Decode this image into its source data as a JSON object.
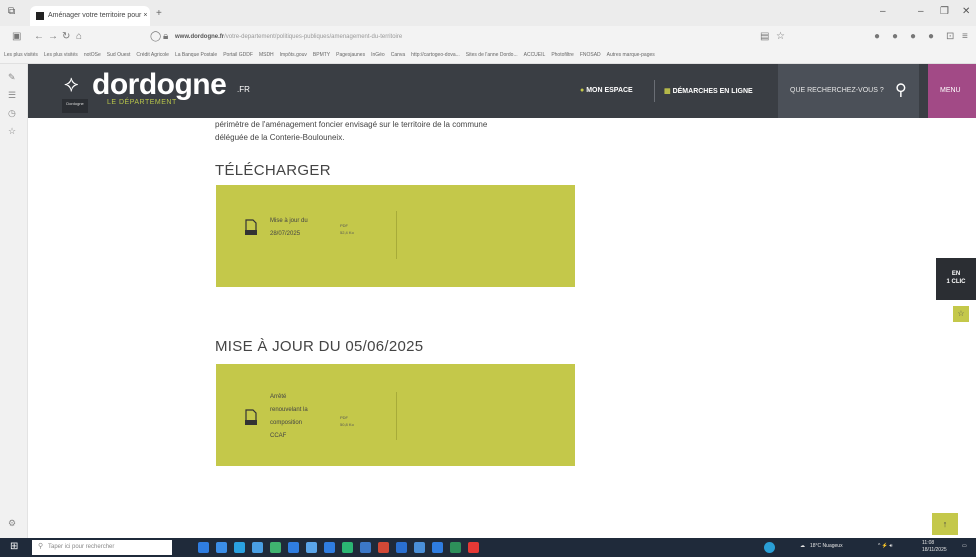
{
  "browser": {
    "tab_title": "Aménager votre territoire pour ×",
    "tab_close": "×",
    "new_tab": "+",
    "url_host": "www.dordogne.fr",
    "url_path": "/votre-departement/politiques-publiques/amenagement-du-territoire",
    "bookmarks": [
      "Les plus visités",
      "Les plus visités",
      "notOSe",
      "Sud Ouest",
      "Crédit Agricole",
      "La Banque Postale",
      "Portail GDDF",
      "MSDH",
      "Impôts.gouv",
      "BPMTY",
      "Pagesjaunes",
      "InGéo",
      "Canva",
      "http://cartogeo-dova...",
      "Sites de l'anne Dordo...",
      "ACCUEIL",
      "Photofiltre",
      "FNOSAD",
      "Autres marque-pages"
    ]
  },
  "site": {
    "logo_text": "dordogne",
    "logo_suffix": ".FR",
    "logo_subtitle": "LE DÉPARTEMENT",
    "logo_badge": "Dordogne",
    "nav": {
      "mon_espace": "MON ESPACE",
      "demarches": "DÉMARCHES EN LIGNE",
      "search_placeholder": "QUE RECHERCHEZ-VOUS ?",
      "menu": "MENU"
    }
  },
  "content": {
    "intro_line1": "périmètre de l'aménagement foncier envisagé sur le territoire de la commune",
    "intro_line2": "déléguée de la Conterie-Boulouneix.",
    "section1_title": "TÉLÉCHARGER",
    "file1": {
      "name_line1": "Mise à jour du",
      "name_line2": "28/07/2025",
      "type": "PDF",
      "size": "52,4 Ko"
    },
    "section2_title": "MISE À JOUR DU 05/06/2025",
    "file2": {
      "name_line1": "Arrêté",
      "name_line2": "renouvelant la",
      "name_line3": "composition",
      "name_line4": "CCAF",
      "type": "PDF",
      "size": "50,8 Ko"
    }
  },
  "floating": {
    "en1clic_line1": "EN",
    "en1clic_line2": "1 CLIC"
  },
  "taskbar": {
    "search_placeholder": "Taper ici pour rechercher",
    "weather": "18°C Nuageux",
    "time": "11:08",
    "date": "18/11/2025"
  },
  "colors": {
    "header_bg": "#3a3e44",
    "accent_green": "#c4c84a",
    "menu_purple": "#a24a86"
  }
}
